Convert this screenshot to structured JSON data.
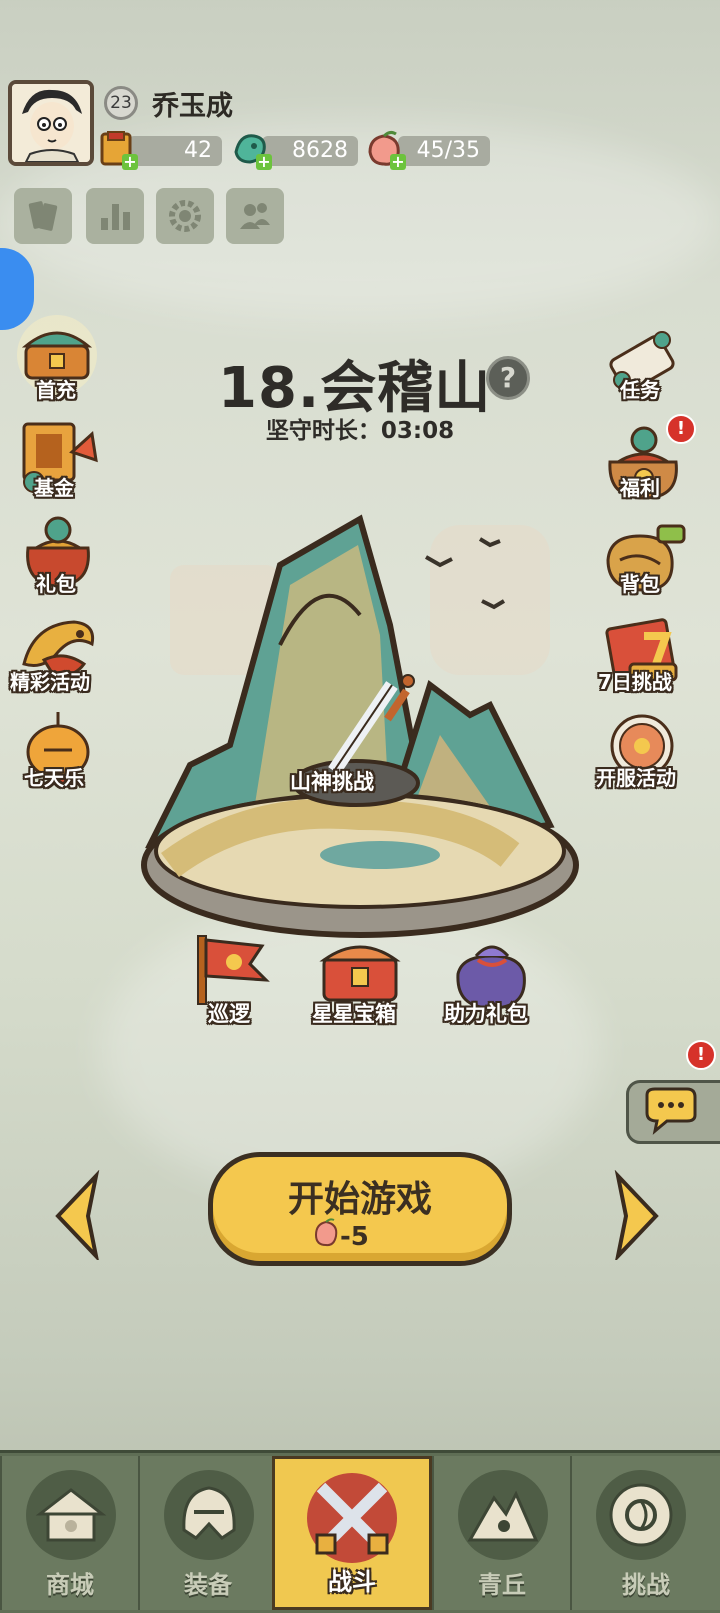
{
  "player": {
    "name": "乔玉成",
    "level": "23"
  },
  "resources": [
    {
      "name": "scroll-gold",
      "value": "42"
    },
    {
      "name": "jade-dragon",
      "value": "8628"
    },
    {
      "name": "peach-stamina",
      "value": "45/35"
    }
  ],
  "top_buttons": [
    "cards-icon",
    "ranking-icon",
    "settings-gear-icon",
    "friends-icon"
  ],
  "left_icons": [
    {
      "label": "首充"
    },
    {
      "label": "基金"
    },
    {
      "label": "礼包"
    },
    {
      "label": "精彩活动"
    },
    {
      "label": "七天乐"
    }
  ],
  "right_icons": [
    {
      "label": "任务",
      "alert": false
    },
    {
      "label": "福利",
      "alert": true
    },
    {
      "label": "背包",
      "alert": false
    },
    {
      "label": "7日挑战",
      "alert": false
    },
    {
      "label": "开服活动",
      "alert": false
    }
  ],
  "stage": {
    "title": "18.会稽山",
    "help": "?",
    "timer_label": "坚守时长：03:08",
    "challenge_label": "山神挑战",
    "sub_buttons": [
      "巡逻",
      "星星宝箱",
      "助力礼包"
    ]
  },
  "start": {
    "label": "开始游戏",
    "cost": "-5"
  },
  "alert_mark": "!",
  "nav": [
    {
      "label": "商城",
      "active": false
    },
    {
      "label": "装备",
      "active": false
    },
    {
      "label": "战斗",
      "active": true
    },
    {
      "label": "青丘",
      "active": false
    },
    {
      "label": "挑战",
      "active": false
    }
  ],
  "colors": {
    "accent_yellow": "#f4c84e",
    "nav_green": "#5f6e55",
    "alert_red": "#d6322a"
  }
}
